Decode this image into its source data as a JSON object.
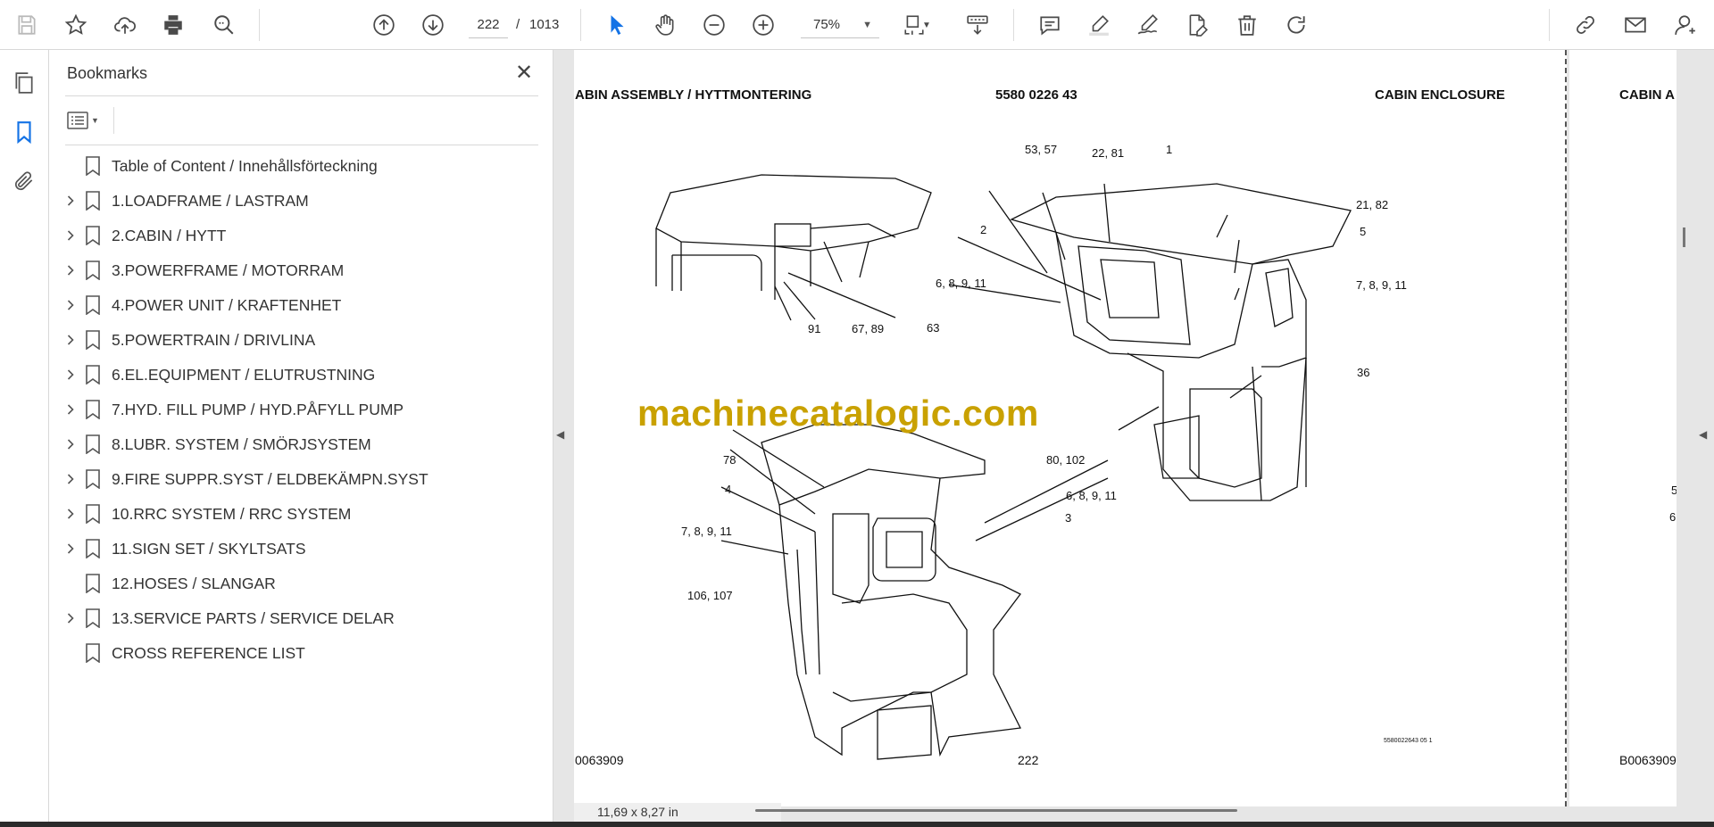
{
  "toolbar": {
    "page_current": "222",
    "page_separator": "/",
    "page_total": "1013",
    "zoom": "75%",
    "icons": [
      "save-icon",
      "star-icon",
      "upload-icon",
      "print-icon",
      "zoom-search-icon",
      "page-up-icon",
      "page-down-icon",
      "select-cursor-icon",
      "hand-icon",
      "zoom-out-icon",
      "zoom-in-icon",
      "page-fit-icon",
      "scroll-mode-icon",
      "comment-icon",
      "highlight-icon",
      "sign-icon",
      "edit-pdf-icon",
      "delete-icon",
      "rotate-icon",
      "share-link-icon",
      "email-icon",
      "account-icon"
    ]
  },
  "panel": {
    "title": "Bookmarks",
    "items": [
      {
        "label": "Table of Content / Innehållsförteckning",
        "expandable": false
      },
      {
        "label": "1.LOADFRAME / LASTRAM",
        "expandable": true
      },
      {
        "label": "2.CABIN / HYTT",
        "expandable": true
      },
      {
        "label": "3.POWERFRAME / MOTORRAM",
        "expandable": true
      },
      {
        "label": "4.POWER UNIT / KRAFTENHET",
        "expandable": true
      },
      {
        "label": "5.POWERTRAIN / DRIVLINA",
        "expandable": true
      },
      {
        "label": "6.EL.EQUIPMENT / ELUTRUSTNING",
        "expandable": true
      },
      {
        "label": "7.HYD. FILL PUMP / HYD.PÅFYLL PUMP",
        "expandable": true
      },
      {
        "label": "8.LUBR. SYSTEM / SMÖRJSYSTEM",
        "expandable": true
      },
      {
        "label": "9.FIRE SUPPR.SYST / ELDBEKÄMPN.SYST",
        "expandable": true
      },
      {
        "label": "10.RRC SYSTEM / RRC SYSTEM",
        "expandable": true
      },
      {
        "label": "11.SIGN SET / SKYLTSATS",
        "expandable": true
      },
      {
        "label": "12.HOSES / SLANGAR",
        "expandable": false
      },
      {
        "label": "13.SERVICE PARTS / SERVICE DELAR",
        "expandable": true
      },
      {
        "label": "CROSS REFERENCE LIST",
        "expandable": false
      }
    ]
  },
  "document": {
    "header_left": "ABIN ASSEMBLY / HYTTMONTERING",
    "header_mid": "5580 0226 43",
    "header_right": "CABIN ENCLOSURE",
    "footer_left": "0063909",
    "footer_page": "222",
    "small_code": "5580022643 05 1",
    "next_header": "CABIN A",
    "next_footer": "B0063909",
    "next_frag_1": "5",
    "next_frag_2": "6",
    "callouts": [
      "53, 57",
      "22, 81",
      "1",
      "21, 82",
      "2",
      "5",
      "6, 8, 9, 11",
      "7, 8, 9, 11",
      "36",
      "91",
      "67, 89",
      "63",
      "78",
      "4",
      "80, 102",
      "6, 8, 9, 11",
      "3",
      "7, 8, 9, 11",
      "106, 107"
    ],
    "watermark": "machinecatalogic.com"
  },
  "status": {
    "page_size": "11,69 x 8,27 in"
  },
  "colors": {
    "accent": "#1473e6",
    "watermark": "#c9a100"
  }
}
